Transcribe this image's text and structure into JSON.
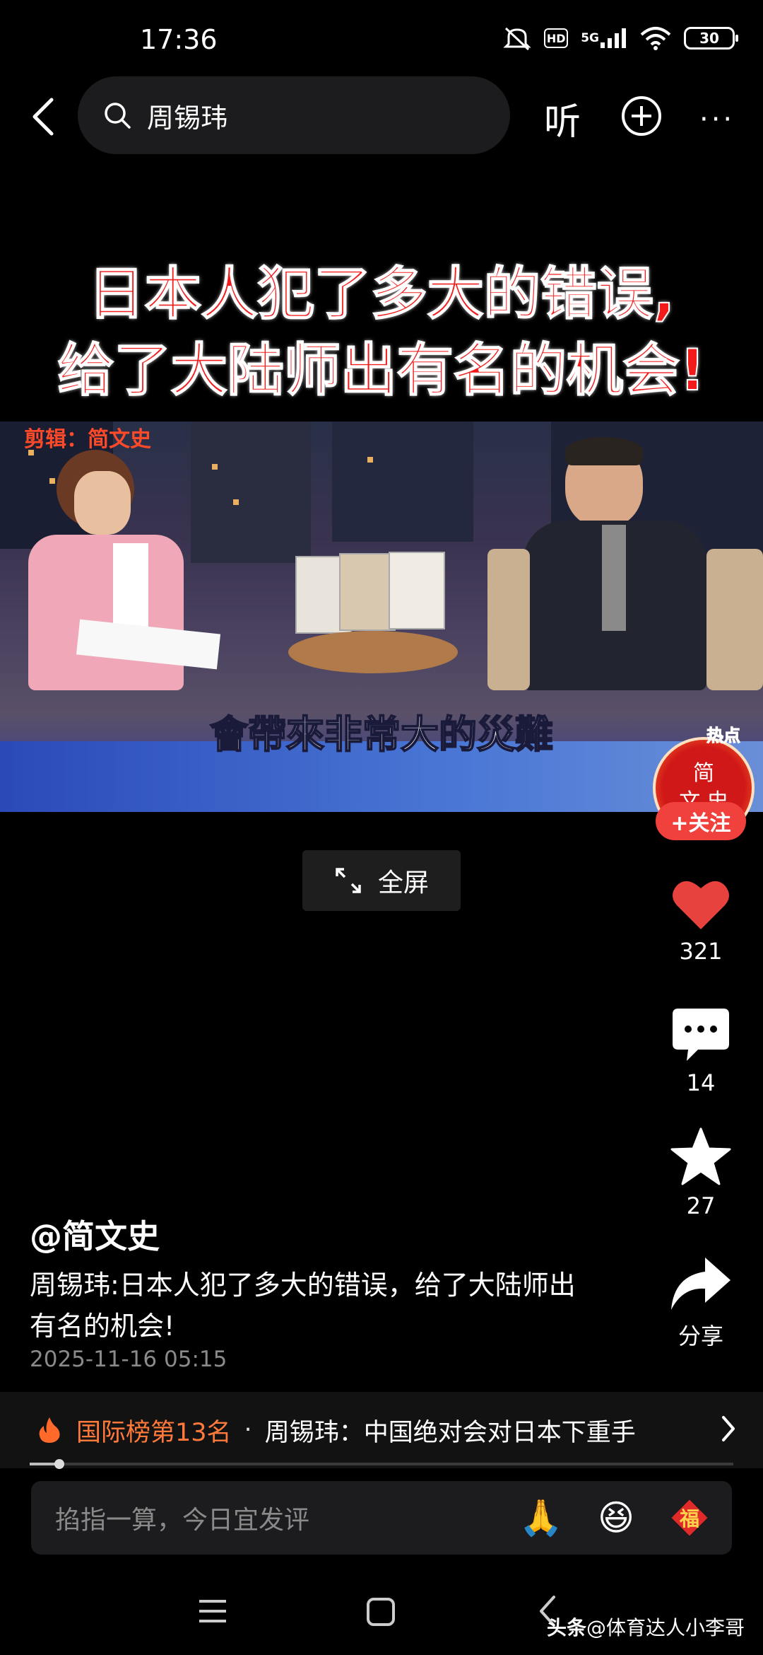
{
  "status_bar": {
    "time": "17:36",
    "hd": "HD",
    "network": "5G",
    "battery": "30"
  },
  "search": {
    "query": "周锡玮",
    "listen_label": "听",
    "more_label": "···"
  },
  "video": {
    "caption_line1": "日本人犯了多大的错误,",
    "caption_line2": "给了大陆师出有名的机会!",
    "editor_tag": "剪辑：简文史",
    "subtitle": "會帶來非常大的災難",
    "logo_text_1": "简",
    "logo_text_2": "文 史",
    "logo_tag": "热点"
  },
  "follow_label": "+关注",
  "fullscreen_label": "全屏",
  "actions": {
    "likes": "321",
    "comments": "14",
    "favorites": "27",
    "share_label": "分享"
  },
  "post": {
    "author": "@简文史",
    "description": "周锡玮:日本人犯了多大的错误，给了大陆师出有名的机会!",
    "timestamp": "2025-11-16 05:15"
  },
  "hot_bar": {
    "rank": "国际榜第13名",
    "separator": "·",
    "title": "周锡玮：中国绝对会对日本下重手"
  },
  "progress": {
    "fraction": 0.042
  },
  "comment": {
    "placeholder": "掐指一算，今日宜发评",
    "emoji_1": "🙏",
    "emoji_2": "😆",
    "emoji_3": "福"
  },
  "watermark": {
    "brand": "头条",
    "handle": "@体育达人小李哥"
  },
  "colors": {
    "accent_red": "#f0413c",
    "hot_orange": "#ff7a3a",
    "like_red": "#e8423e"
  }
}
